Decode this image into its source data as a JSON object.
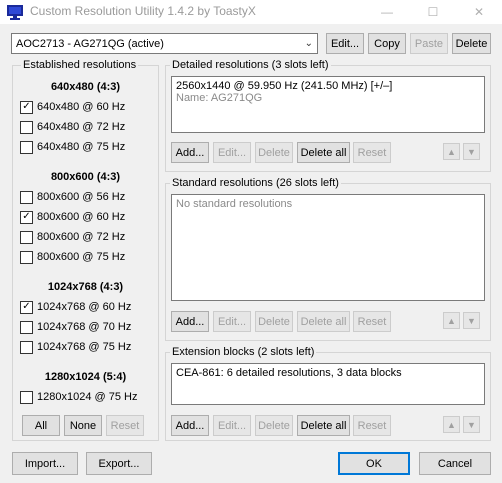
{
  "window": {
    "title": "Custom Resolution Utility 1.4.2 by ToastyX",
    "controls": {
      "minimize": "—",
      "maximize": "☐",
      "close": "✕"
    }
  },
  "top": {
    "monitor_selected": "AOC2713 - AG271QG (active)",
    "edit_label": "Edit...",
    "copy_label": "Copy",
    "paste_label": "Paste",
    "delete_label": "Delete"
  },
  "established": {
    "title": "Established resolutions",
    "groups": [
      {
        "header": "640x480 (4:3)",
        "items": [
          {
            "label": "640x480 @ 60 Hz",
            "checked": true
          },
          {
            "label": "640x480 @ 72 Hz",
            "checked": false
          },
          {
            "label": "640x480 @ 75 Hz",
            "checked": false
          }
        ]
      },
      {
        "header": "800x600 (4:3)",
        "items": [
          {
            "label": "800x600 @ 56 Hz",
            "checked": false
          },
          {
            "label": "800x600 @ 60 Hz",
            "checked": true
          },
          {
            "label": "800x600 @ 72 Hz",
            "checked": false
          },
          {
            "label": "800x600 @ 75 Hz",
            "checked": false
          }
        ]
      },
      {
        "header": "1024x768 (4:3)",
        "items": [
          {
            "label": "1024x768 @ 60 Hz",
            "checked": true
          },
          {
            "label": "1024x768 @ 70 Hz",
            "checked": false
          },
          {
            "label": "1024x768 @ 75 Hz",
            "checked": false
          }
        ]
      },
      {
        "header": "1280x1024 (5:4)",
        "items": [
          {
            "label": "1280x1024 @ 75 Hz",
            "checked": false
          }
        ]
      }
    ],
    "all_label": "All",
    "none_label": "None",
    "reset_label": "Reset"
  },
  "detailed": {
    "title": "Detailed resolutions (3 slots left)",
    "line1": "2560x1440 @ 59.950 Hz (241.50 MHz) [+/–]",
    "line2": "Name: AG271QG",
    "add": "Add...",
    "edit": "Edit...",
    "delete": "Delete",
    "delete_all": "Delete all",
    "reset": "Reset"
  },
  "standard": {
    "title": "Standard resolutions (26 slots left)",
    "empty": "No standard resolutions",
    "add": "Add...",
    "edit": "Edit...",
    "delete": "Delete",
    "delete_all": "Delete all",
    "reset": "Reset"
  },
  "extension": {
    "title": "Extension blocks (2 slots left)",
    "line1": "CEA-861: 6 detailed resolutions, 3 data blocks",
    "add": "Add...",
    "edit": "Edit...",
    "delete": "Delete",
    "delete_all": "Delete all",
    "reset": "Reset"
  },
  "bottom": {
    "import_label": "Import...",
    "export_label": "Export...",
    "ok_label": "OK",
    "cancel_label": "Cancel"
  },
  "icons": {
    "up": "arrow-up-icon",
    "down": "arrow-down-icon",
    "app": "monitor-app-icon"
  },
  "colors": {
    "accent": "#0078d7",
    "disabled_text": "#a0a0a0",
    "app_icon": "#1a2a9a"
  }
}
